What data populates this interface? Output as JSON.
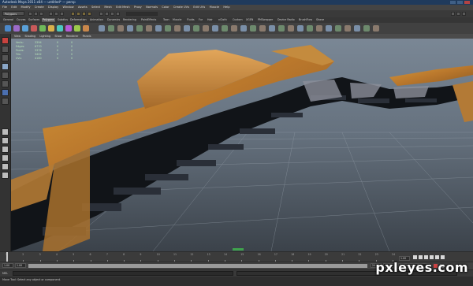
{
  "window": {
    "title": "Autodesk Maya 2011 x64 — untitled* — persp"
  },
  "menubar": {
    "items": [
      "File",
      "Edit",
      "Modify",
      "Create",
      "Display",
      "Window",
      "Assets",
      "Select",
      "Mesh",
      "Edit Mesh",
      "Proxy",
      "Normals",
      "Color",
      "Create UVs",
      "Edit UVs",
      "Muscle",
      "Help"
    ]
  },
  "statusline": {
    "mode": "Polygons"
  },
  "shelf": {
    "tabs": [
      "General",
      "Curves",
      "Surfaces",
      "Polygons",
      "Subdivs",
      "Deformation",
      "Animation",
      "Dynamics",
      "Rendering",
      "PaintEffects",
      "Toon",
      "Muscle",
      "Fluids",
      "Fur",
      "Hair",
      "nCloth",
      "Custom",
      "XGEN",
      "PMSwapper",
      "Device Radio",
      "BrushFlow",
      "Shave"
    ],
    "active_tab": "Polygons",
    "icon_colors": [
      "#4b88c9",
      "#9c6bc9",
      "#5aa1d8",
      "#c95a5a",
      "#6fba5a",
      "#d8b04b",
      "#4bc9c0",
      "#b55ad8",
      "#9cc94b",
      "#c9874b"
    ]
  },
  "viewport": {
    "panel_menu": [
      "View",
      "Shading",
      "Lighting",
      "Show",
      "Renderer",
      "Panels"
    ],
    "hud": {
      "rows": [
        {
          "label": "Verts:",
          "a": "3394",
          "b": "0",
          "c": "0"
        },
        {
          "label": "Edges:",
          "a": "6770",
          "b": "0",
          "c": "0"
        },
        {
          "label": "Faces:",
          "a": "3378",
          "b": "0",
          "c": "0"
        },
        {
          "label": "Tris:",
          "a": "3402",
          "b": "0",
          "c": "0"
        },
        {
          "label": "UVs:",
          "a": "4180",
          "b": "0",
          "c": "0"
        }
      ]
    }
  },
  "timeslider": {
    "ticks": [
      "1",
      "2",
      "3",
      "4",
      "5",
      "6",
      "7",
      "8",
      "9",
      "10",
      "11",
      "12",
      "13",
      "14",
      "15",
      "16",
      "17",
      "18",
      "19",
      "20",
      "21",
      "22",
      "23",
      "24"
    ],
    "current_frame": "1.00"
  },
  "rangeslider": {
    "start": "1.00",
    "inner_start": "1.00",
    "inner_end": "24.00",
    "end": "48.00",
    "character_set": "No Character Set"
  },
  "cmdline": {
    "label": "MEL"
  },
  "helpline": {
    "text": "Move Tool: Select any object or component."
  },
  "watermark": {
    "text": "pxleyes.com"
  }
}
